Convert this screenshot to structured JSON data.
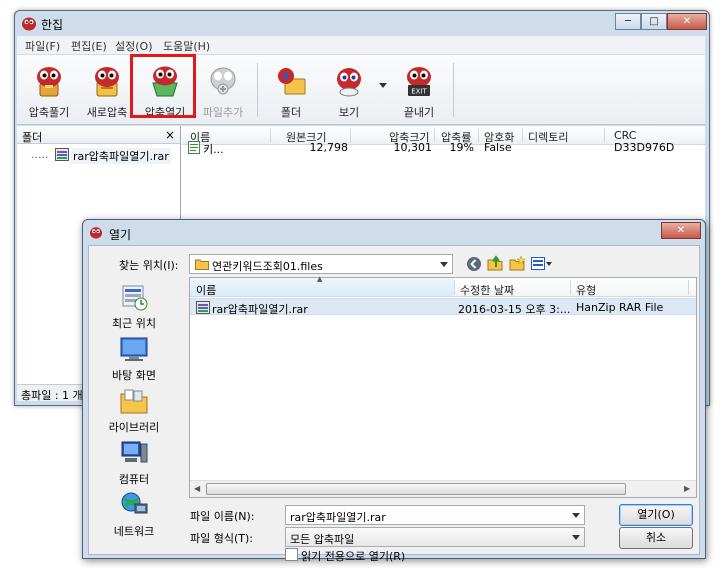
{
  "main_window": {
    "title": "한집",
    "caption": {
      "minimize": "─",
      "maximize": "□",
      "close": "✕"
    },
    "menu": [
      "파일(F)",
      "편집(E)",
      "설정(O)",
      "도움말(H)"
    ],
    "toolbar": [
      {
        "label": "압축풀기",
        "enabled": true
      },
      {
        "label": "새로압축",
        "enabled": true
      },
      {
        "label": "압축열기",
        "enabled": true
      },
      {
        "label": "파일추가",
        "enabled": false
      },
      {
        "label": "폴더",
        "enabled": true
      },
      {
        "label": "보기",
        "enabled": true
      },
      {
        "label": "끝내기",
        "enabled": true
      }
    ],
    "exit_icon_text": "EXIT",
    "folder_pane": {
      "header": "폴더",
      "close": "×",
      "tree_item": "rar압축파일열기.rar",
      "tree_prefix": "....."
    },
    "file_list": {
      "columns": [
        "이름",
        "원본크기",
        "압축크기",
        "압축률",
        "암호화",
        "디렉토리",
        "CRC"
      ],
      "rows": [
        {
          "name": "키...",
          "original": "12,798",
          "compressed": "10,301",
          "ratio": "19%",
          "encrypted": "False",
          "directory": "",
          "crc": "D33D976D"
        }
      ]
    },
    "status": "총파일 : 1 개"
  },
  "dialog": {
    "title": "열기",
    "close": "✕",
    "look_in_label": "찾는 위치(I):",
    "look_in_value": "연관키워드조회01.files",
    "places": [
      "최근 위치",
      "바탕 화면",
      "라이브러리",
      "컴퓨터",
      "네트워크"
    ],
    "columns": [
      "이름",
      "수정한 날짜",
      "유형"
    ],
    "sort_indicator": "▲",
    "files": [
      {
        "name": "rar압축파일열기.rar",
        "date": "2016-03-15 오후 3:...",
        "type": "HanZip RAR File"
      }
    ],
    "filename_label": "파일 이름(N):",
    "filename_value": "rar압축파일열기.rar",
    "filetype_label": "파일 형식(T):",
    "filetype_value": "모든 압축파일",
    "readonly_label": "읽기 전용으로 열기(R)",
    "open_button": "열기(O)",
    "cancel_button": "취소"
  },
  "colors": {
    "highlight": "#e3181a",
    "window_frame": "#cfdcec",
    "selection": "#dde8f5"
  }
}
